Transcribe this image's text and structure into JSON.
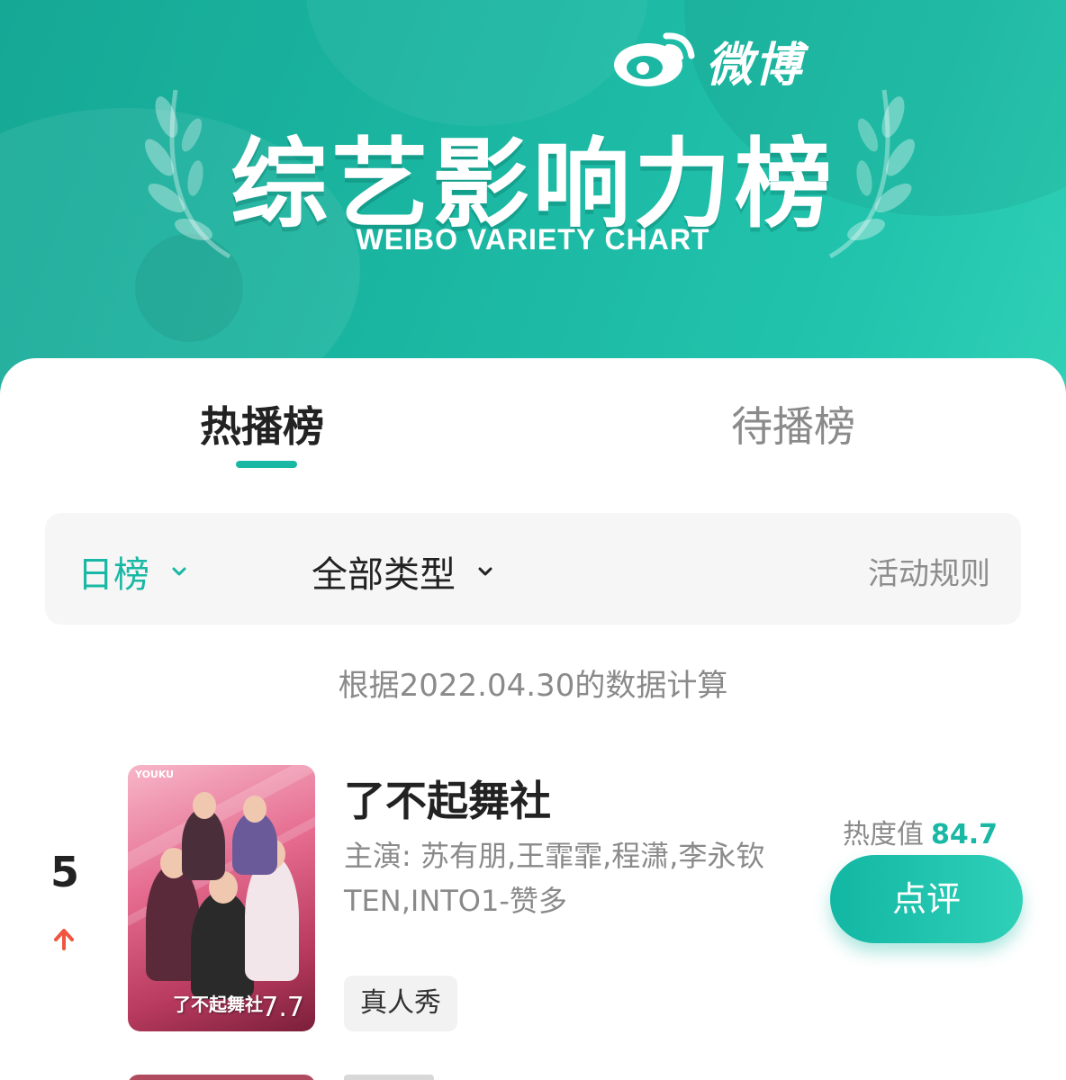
{
  "banner": {
    "brand": "微博",
    "title": "综艺影响力榜",
    "subtitle": "WEIBO VARIETY CHART",
    "bg_color": "#1bb7a2"
  },
  "tabs": [
    {
      "label": "热播榜",
      "active": true
    },
    {
      "label": "待播榜",
      "active": false
    }
  ],
  "filters": {
    "period": "日榜",
    "type": "全部类型",
    "rules": "活动规则"
  },
  "data_note": "根据2022.04.30的数据计算",
  "entry": {
    "rank": "5",
    "trend": "up",
    "poster_caption": "了不起舞社",
    "poster_score": "7.7",
    "poster_brand": "YOUKU",
    "title": "了不起舞社",
    "cast": "主演: 苏有朋,王霏霏,程潇,李永钦TEN,INTO1-赞多",
    "genre": "真人秀",
    "heat_label": "热度值",
    "heat_value": "84.7",
    "review_button": "点评"
  },
  "colors": {
    "accent": "#19b8a4",
    "trend_up": "#f0563f"
  }
}
